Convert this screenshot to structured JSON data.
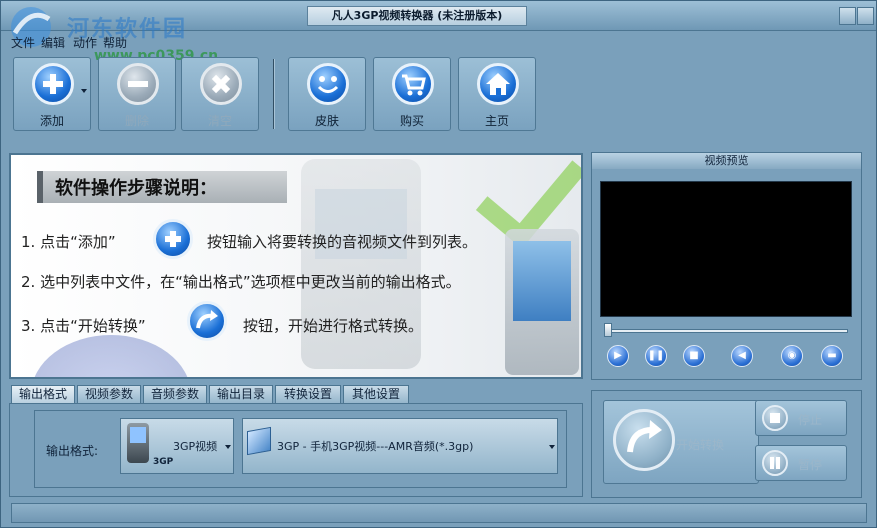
{
  "window": {
    "title": "凡人3GP视频转换器 (未注册版本)"
  },
  "watermark": {
    "text": "河东软件园",
    "url": "www.pc0359.cn"
  },
  "menu": [
    "文件",
    "编辑",
    "动作",
    "帮助"
  ],
  "toolbar": {
    "add": "添加",
    "remove": "删除",
    "clear": "清空",
    "skin": "皮肤",
    "buy": "购买",
    "home": "主页"
  },
  "guide": {
    "heading": "软件操作步骤说明：",
    "step1_a": "1. 点击“添加”",
    "step1_b": "按钮输入将要转换的音视频文件到列表。",
    "step2": "2. 选中列表中文件，在“输出格式”选项框中更改当前的输出格式。",
    "step3_a": "3. 点击“开始转换”",
    "step3_b": "按钮，开始进行格式转换。"
  },
  "preview": {
    "title": "视频预览"
  },
  "tabs": [
    "输出格式",
    "视频参数",
    "音频参数",
    "输出目录",
    "转换设置",
    "其他设置"
  ],
  "format": {
    "label": "输出格式:",
    "device_value": "3GP视频",
    "device_caption": "3GP",
    "profile_value": "3GP - 手机3GP视频---AMR音频(*.3gp)"
  },
  "convert": {
    "start": "开始转换",
    "stop": "停止",
    "pause": "暂停"
  },
  "icons": {
    "play": "play-icon",
    "pause": "pause-icon",
    "stop": "stop-icon",
    "volume": "volume-icon",
    "snapshot": "camera-icon",
    "folder": "folder-icon"
  },
  "colors": {
    "window_bg": "#7aa0bb",
    "accent_blue": "#1a6fd6",
    "video_bg": "#000000"
  }
}
